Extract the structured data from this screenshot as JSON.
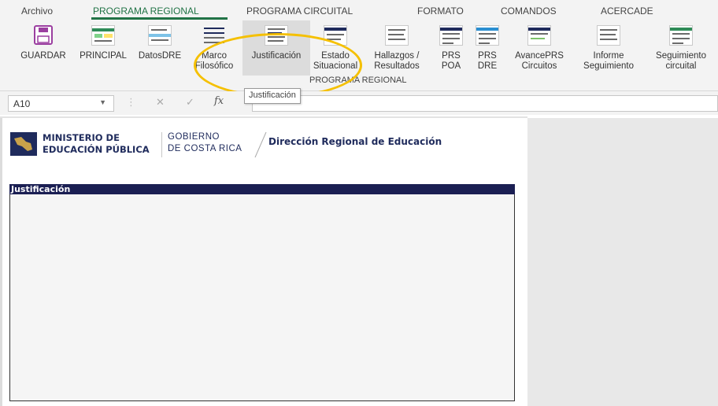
{
  "tabs": [
    "Archivo",
    "PROGRAMA REGIONAL",
    "PROGRAMA CIRCUITAL",
    "FORMATO",
    "COMANDOS",
    "ACERCADE"
  ],
  "ribbon": {
    "buttons": [
      {
        "label": "GUARDAR",
        "icon": "save-icon"
      },
      {
        "label": "PRINCIPAL",
        "icon": "dashboard-thumbnail-icon"
      },
      {
        "label": "DatosDRE",
        "icon": "data-sheet-thumbnail-icon"
      },
      {
        "label_line1": "Marco",
        "label_line2": "Filosófico",
        "icon": "document-thumbnail-icon"
      },
      {
        "label": "Justificación",
        "icon": "document-thumbnail-icon"
      },
      {
        "label_line1": "Estado",
        "label_line2": "Situacional",
        "icon": "document-thumbnail-icon"
      },
      {
        "label_line1": "Hallazgos /",
        "label_line2": "Resultados",
        "icon": "document-thumbnail-icon"
      },
      {
        "label_line1": "PRS",
        "label_line2": "POA",
        "icon": "table-thumbnail-icon"
      },
      {
        "label_line1": "PRS",
        "label_line2": "DRE",
        "icon": "table-thumbnail-icon"
      },
      {
        "label_line1": "AvancePRS",
        "label_line2": "Circuitos",
        "icon": "table-thumbnail-icon"
      },
      {
        "label_line1": "Informe",
        "label_line2": "Seguimiento",
        "icon": "document-thumbnail-icon"
      },
      {
        "label_line1": "Seguimiento",
        "label_line2": "circuital",
        "icon": "table-thumbnail-icon"
      }
    ],
    "group_label": "PROGRAMA REGIONAL"
  },
  "formula_bar": {
    "name_box": "A10",
    "fx_symbol": "fx",
    "cancel_symbol": "✕",
    "enter_symbol": "✓",
    "tooltip": "Justificación"
  },
  "sheet": {
    "logo_line1": "MINISTERIO DE",
    "logo_line2": "EDUCACIÓN PÚBLICA",
    "gob_line1": "GOBIERNO",
    "gob_line2": "DE COSTA RICA",
    "dre_title": "Dirección Regional de Educación",
    "section_title": "Justificación"
  },
  "colors": {
    "accent": "#217346",
    "header_navy": "#1b1f53",
    "highlight": "#f5c000"
  }
}
